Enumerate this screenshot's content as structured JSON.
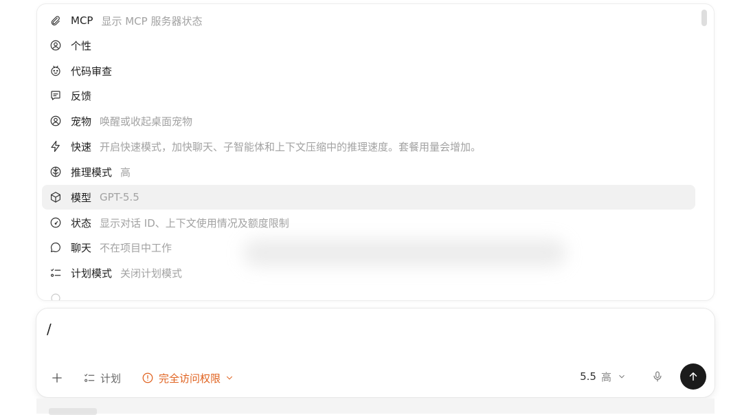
{
  "menu": {
    "items": [
      {
        "icon": "paperclip-icon",
        "label": "MCP",
        "desc": "显示 MCP 服务器状态",
        "selected": false
      },
      {
        "icon": "user-circle-icon",
        "label": "个性",
        "desc": "",
        "selected": false
      },
      {
        "icon": "bug-face-icon",
        "label": "代码审查",
        "desc": "",
        "selected": false
      },
      {
        "icon": "feedback-icon",
        "label": "反馈",
        "desc": "",
        "selected": false
      },
      {
        "icon": "pet-icon",
        "label": "宠物",
        "desc": "唤醒或收起桌面宠物",
        "selected": false
      },
      {
        "icon": "lightning-icon",
        "label": "快速",
        "desc": "开启快速模式，加快聊天、子智能体和上下文压缩中的推理速度。套餐用量会增加。",
        "selected": false
      },
      {
        "icon": "brain-icon",
        "label": "推理模式",
        "desc": "高",
        "selected": false
      },
      {
        "icon": "cube-icon",
        "label": "模型",
        "desc": "GPT-5.5",
        "selected": true
      },
      {
        "icon": "gauge-icon",
        "label": "状态",
        "desc": "显示对话 ID、上下文使用情况及额度限制",
        "selected": false
      },
      {
        "icon": "chat-bubble-icon",
        "label": "聊天",
        "desc": "不在项目中工作",
        "selected": false
      },
      {
        "icon": "checklist-icon",
        "label": "计划模式",
        "desc": "关闭计划模式",
        "selected": false
      }
    ]
  },
  "composer": {
    "input_value": "/",
    "plan_label": "计划",
    "access_label": "完全访问权限",
    "model_version": "5.5",
    "model_effort": "高"
  },
  "colors": {
    "accent_warning": "#e0621f",
    "send_button": "#1b1b1b",
    "selected_row": "#f1f1f1"
  }
}
